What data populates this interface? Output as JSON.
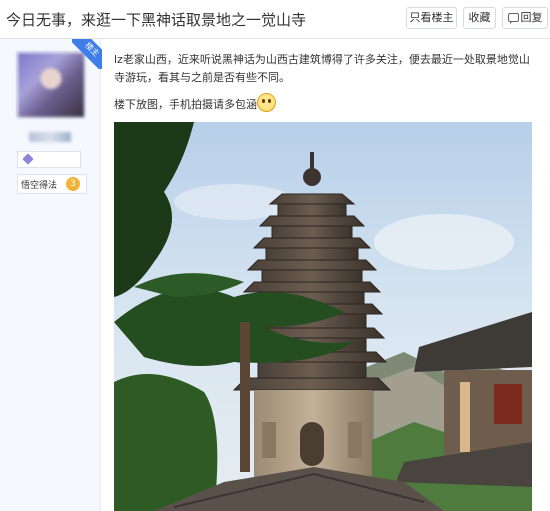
{
  "header": {
    "title": "今日无事，来逛一下黑神话取景地之一觉山寺",
    "buttons": {
      "only_op": "只看楼主",
      "favorite": "收藏",
      "reply": "回复"
    }
  },
  "author": {
    "badge": "楼主",
    "level_label": "悟空得法",
    "level_number": "3"
  },
  "post": {
    "paragraph1": "lz老家山西，近来听说黑神话为山西古建筑博得了许多关注，便去最近一处取景地觉山寺游玩，看其与之前是否有些不同。",
    "paragraph2": "楼下放图，手机拍摄请多包涵"
  },
  "photo": {
    "icon": "pagoda-photo"
  },
  "colors": {
    "badge_blue": "#3f7ee8",
    "level_gold": "#f2b236"
  }
}
